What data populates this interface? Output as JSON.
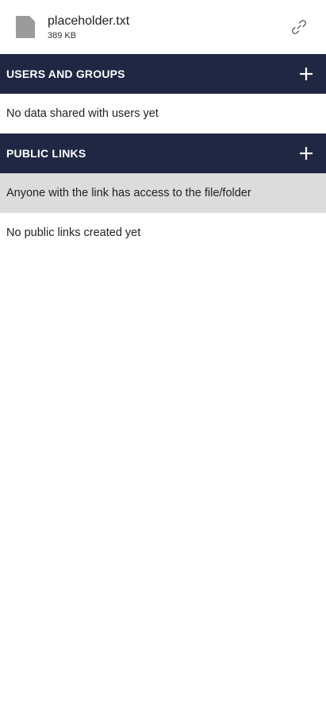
{
  "file": {
    "name": "placeholder.txt",
    "size": "389 KB",
    "icon": "file-icon",
    "link_icon": "link-icon"
  },
  "users_section": {
    "title": "USERS AND GROUPS",
    "empty_text": "No data shared with users yet"
  },
  "links_section": {
    "title": "PUBLIC LINKS",
    "info_text": "Anyone with the link has access to the file/folder",
    "empty_text": "No public links created yet"
  },
  "colors": {
    "header_bg": "#1f2743",
    "info_bg": "#dcdcdc",
    "icon_gray": "#9b9b9b"
  }
}
